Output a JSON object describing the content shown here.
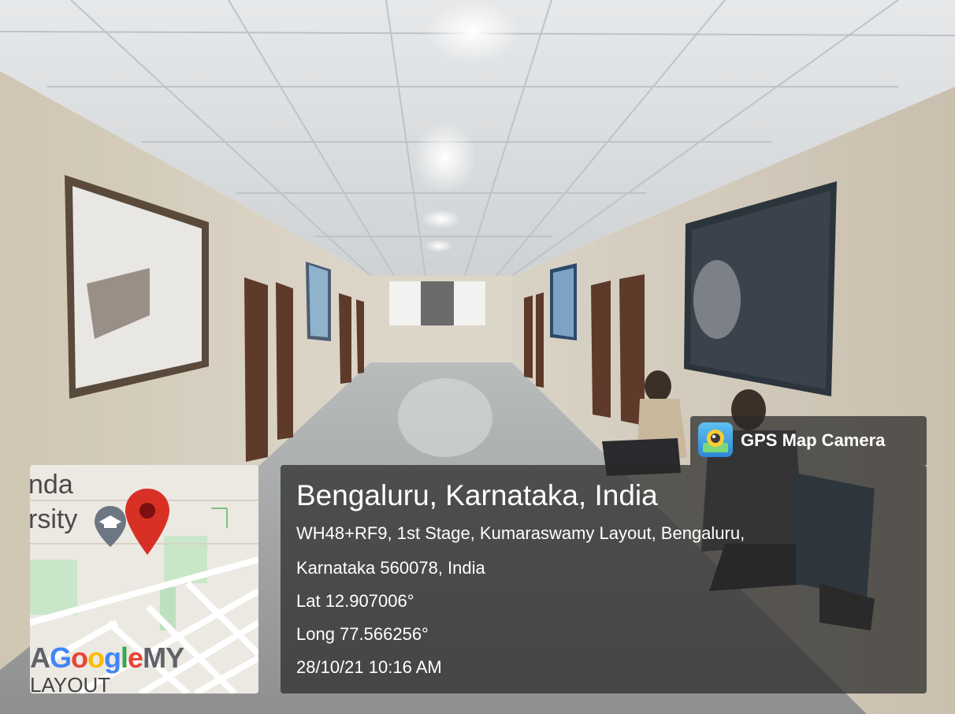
{
  "overlay": {
    "badge_label": "GPS Map Camera",
    "badge_icon": "gps-map-camera-app-icon",
    "location_title": "Bengaluru, Karnataka, India",
    "address_line_1": "WH48+RF9, 1st Stage, Kumaraswamy Layout, Bengaluru,",
    "address_line_2": "Karnataka 560078, India",
    "latitude": "Lat 12.907006°",
    "longitude": "Long 77.566256°",
    "datetime": "28/10/21 10:16 AM"
  },
  "map": {
    "label_partial_1": "nda",
    "label_partial_2": "rsity",
    "google_logo": "AGoogleMY",
    "bottom_text": "LAYOUT",
    "pin_color": "#d93025",
    "pin_icon": "map-pin-icon",
    "poi_icon": "university-poi-icon"
  },
  "colors": {
    "overlay_bg": "#282828",
    "overlay_text": "#ffffff"
  }
}
